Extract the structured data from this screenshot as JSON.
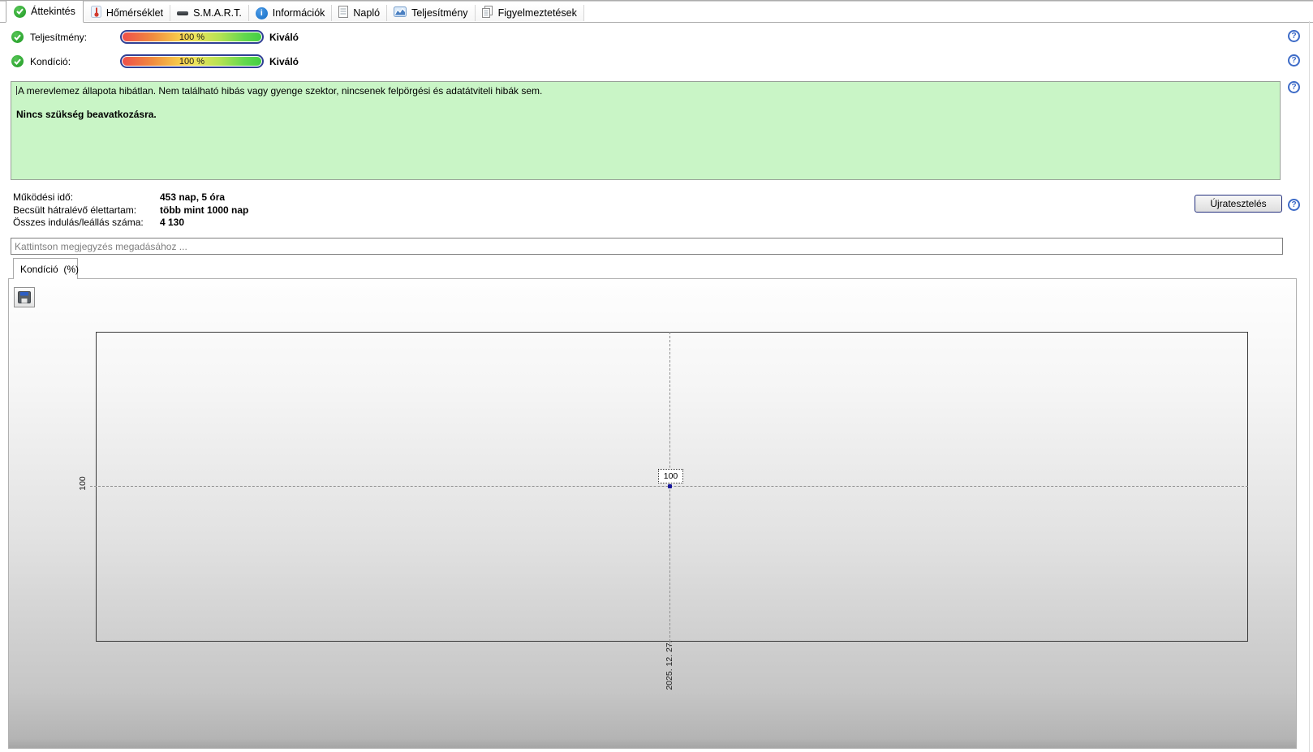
{
  "tabs": {
    "items": [
      {
        "label": "Áttekintés",
        "icon": "check-circle",
        "active": true
      },
      {
        "label": "Hőmérséklet",
        "icon": "thermometer",
        "active": false
      },
      {
        "label": "S.M.A.R.T.",
        "icon": "disk",
        "active": false
      },
      {
        "label": "Információk",
        "icon": "info",
        "active": false
      },
      {
        "label": "Napló",
        "icon": "document",
        "active": false
      },
      {
        "label": "Teljesítmény",
        "icon": "chart",
        "active": false
      },
      {
        "label": "Figyelmeztetések",
        "icon": "pages",
        "active": false
      }
    ]
  },
  "icons": {
    "info_glyph": "i",
    "help_glyph": "?"
  },
  "gauges": {
    "performance": {
      "label": "Teljesítmény:",
      "value": "100 %",
      "rating": "Kiváló"
    },
    "condition": {
      "label": "Kondíció:",
      "value": "100 %",
      "rating": "Kiváló"
    }
  },
  "status_box": {
    "line1": "A merevlemez állapota hibátlan. Nem található hibás vagy gyenge szektor, nincsenek felpörgési és adatátviteli hibák sem.",
    "line2": "Nincs szükség beavatkozásra.",
    "bg_color": "#c9f5c6"
  },
  "stats": {
    "rows": [
      {
        "label": "Működési idő:",
        "value": "453 nap, 5 óra"
      },
      {
        "label": "Becsült hátralévő élettartam:",
        "value": "több mint 1000 nap"
      },
      {
        "label": "Összes indulás/leállás száma:",
        "value": "4 130"
      }
    ]
  },
  "actions": {
    "retest_label": "Újratesztelés"
  },
  "comment": {
    "placeholder": "Kattintson megjegyzés megadásához ..."
  },
  "chart_tab": {
    "label": "Kondíció  (%)"
  },
  "chart": {
    "y_axis_label": "100",
    "x_axis_label": "2025. 12. 27.",
    "point_label": "100"
  },
  "chart_data": {
    "type": "line",
    "title": "Kondíció (%)",
    "x": [
      "2025. 12. 27."
    ],
    "series": [
      {
        "name": "Kondíció (%)",
        "values": [
          100
        ]
      }
    ],
    "y_ticks": [
      100
    ],
    "point_labels": [
      "100"
    ],
    "grid": "crosshair-dashed",
    "legend_position": "none"
  },
  "colors": {
    "status_green": "#c9f5c6",
    "gauge_border": "#2f3f94",
    "help_blue": "#3d6bc7",
    "check_green": "#1f9a24",
    "point_navy": "#16169a"
  }
}
